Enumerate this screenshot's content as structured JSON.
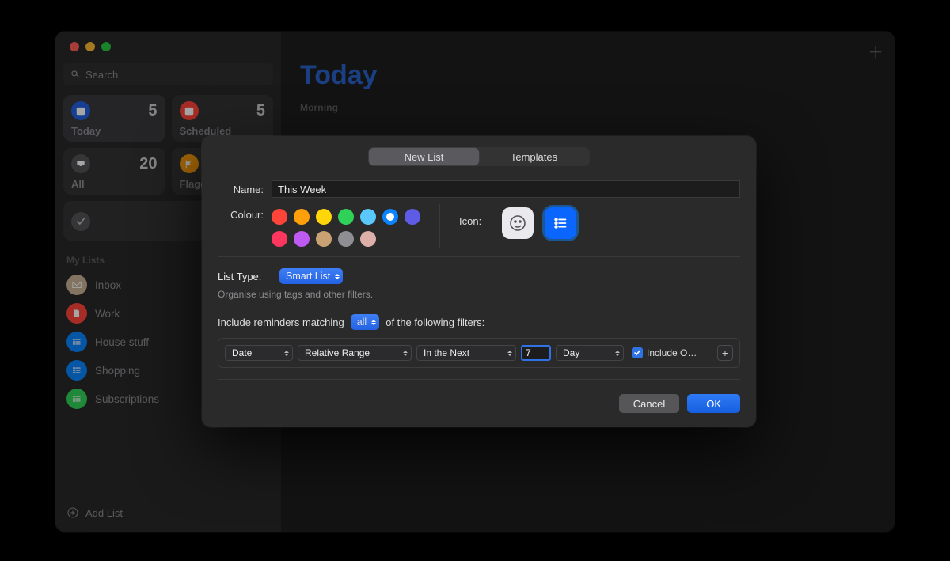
{
  "search": {
    "placeholder": "Search"
  },
  "smartCards": [
    {
      "label": "Today",
      "count": "5",
      "bg": "#2362e4",
      "icon": "calendar"
    },
    {
      "label": "Scheduled",
      "count": "5",
      "bg": "#ff453a",
      "icon": "calendar"
    },
    {
      "label": "All",
      "count": "20",
      "bg": "#3a3a3c",
      "icon": "tray"
    },
    {
      "label": "Flagged",
      "count": "",
      "bg": "#ff9f0a",
      "icon": "flag"
    }
  ],
  "completed": {
    "label": "Completed"
  },
  "sidebar": {
    "sectionTitle": "My Lists",
    "items": [
      {
        "name": "Inbox",
        "color": "#c8b295",
        "icon": "envelope"
      },
      {
        "name": "Work",
        "color": "#ff453a",
        "icon": "doc"
      },
      {
        "name": "House stuff",
        "color": "#0a84ff",
        "icon": "list"
      },
      {
        "name": "Shopping",
        "color": "#0a84ff",
        "icon": "list"
      },
      {
        "name": "Subscriptions",
        "color": "#30d158",
        "icon": "list"
      }
    ]
  },
  "addList": "Add List",
  "main": {
    "title": "Today",
    "section": "Morning"
  },
  "modal": {
    "tabs": {
      "newList": "New List",
      "templates": "Templates"
    },
    "nameLabel": "Name:",
    "nameValue": "This Week",
    "colourLabel": "Colour:",
    "colours": [
      "#ff453a",
      "#ff9f0a",
      "#ffd60a",
      "#30d158",
      "#5ac8fa",
      "#0a84ff",
      "#5e5ce6",
      "#ff375f",
      "#bf5af2",
      "#c8a273",
      "#8e8e93",
      "#e6a5a5"
    ],
    "selectedColourIndex": 5,
    "iconLabel": "Icon:",
    "listTypeLabel": "List Type:",
    "listTypeValue": "Smart List",
    "listTypeHint": "Organise using tags and other filters.",
    "matchPrefix": "Include reminders matching",
    "matchMode": "all",
    "matchSuffix": "of the following filters:",
    "filter": {
      "field": "Date",
      "op": "Relative Range",
      "direction": "In the Next",
      "amount": "7",
      "unit": "Day",
      "includeLabel": "Include O…"
    },
    "buttons": {
      "cancel": "Cancel",
      "ok": "OK"
    }
  }
}
